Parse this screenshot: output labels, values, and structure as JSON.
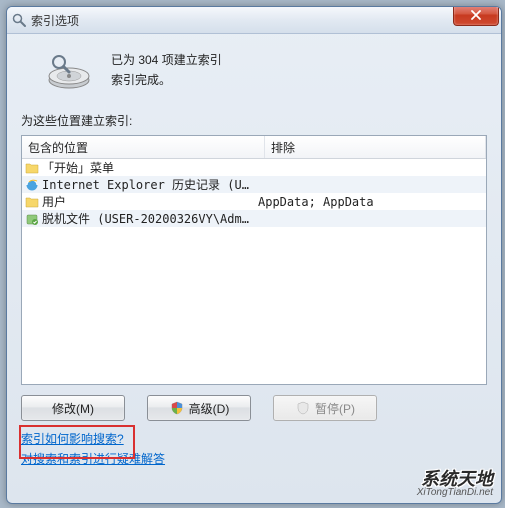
{
  "window": {
    "title": "索引选项"
  },
  "status": {
    "line1": "已为 304 项建立索引",
    "line2": "索引完成。"
  },
  "section_label": "为这些位置建立索引:",
  "columns": {
    "c1": "包含的位置",
    "c2": "排除"
  },
  "rows": [
    {
      "icon": "folder",
      "location": "「开始」菜单",
      "exclude": ""
    },
    {
      "icon": "ie",
      "location": "Internet Explorer 历史记录 (USE...",
      "exclude": ""
    },
    {
      "icon": "folder",
      "location": "用户",
      "exclude": "AppData; AppData"
    },
    {
      "icon": "offline",
      "location": "脱机文件 (USER-20200326VY\\Admin...",
      "exclude": ""
    }
  ],
  "buttons": {
    "modify": "修改(M)",
    "advanced": "高级(D)",
    "pause": "暂停(P)"
  },
  "links": {
    "l1": "索引如何影响搜索?",
    "l2": "对搜索和索引进行疑难解答"
  },
  "watermark": {
    "line1": "系统天地",
    "line2": "XiTongTianDi.net"
  }
}
